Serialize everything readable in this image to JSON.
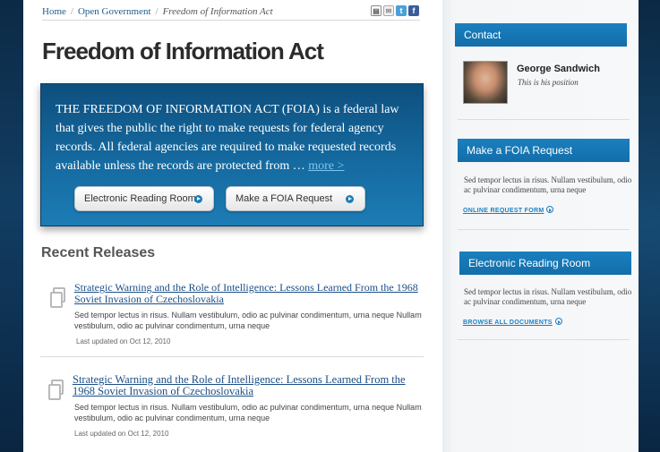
{
  "breadcrumb": {
    "home": "Home",
    "section": "Open Government",
    "current": "Freedom of Information Act"
  },
  "share": {
    "print_icon": "printer-icon",
    "email_icon": "envelope-icon",
    "twitter_icon": "twitter-icon",
    "facebook_icon": "facebook-icon"
  },
  "page_title": "Freedom of Information Act",
  "intro": {
    "text": "THE FREEDOM OF INFORMATION ACT (FOIA) is a federal law that gives the public the right to make requests for federal agency records. All federal agencies are required to make requested records available unless the records are protected from … ",
    "more": "more >",
    "button_reading_room": "Electronic Reading Room",
    "button_foia_request": "Make a FOIA Request"
  },
  "recent": {
    "title": "Recent Releases",
    "items": [
      {
        "title": "Strategic Warning and the Role of Intelligence: Lessons Learned From the 1968 Soviet Invasion of Czechoslovakia",
        "desc": "Sed tempor lectus in risus. Nullam vestibulum, odio ac pulvinar condimentum, urna neque Nullam vestibulum, odio ac pulvinar condimentum, urna neque",
        "date": "Last updated on   Oct 12, 2010"
      },
      {
        "title": "Strategic Warning and the Role of Intelligence: Lessons Learned From the 1968 Soviet Invasion of Czechoslovakia",
        "desc": "Sed tempor lectus in risus. Nullam vestibulum, odio ac pulvinar condimentum, urna neque Nullam vestibulum, odio ac pulvinar condimentum, urna neque",
        "date": "Last updated on   Oct 12, 2010"
      }
    ]
  },
  "sidebar": {
    "contact": {
      "header": "Contact",
      "name": "George Sandwich",
      "position": "This is his position"
    },
    "foia": {
      "header": "Make a FOIA Request",
      "desc": "Sed tempor lectus in risus. Nullam vestibulum, odio ac pulvinar condimentum, urna neque",
      "link": "ONLINE REQUEST FORM"
    },
    "reading_room": {
      "header": "Electronic Reading Room",
      "desc": "Sed tempor lectus in risus. Nullam vestibulum, odio ac pulvinar condimentum, urna neque",
      "link": "BROWSE ALL DOCUMENTS"
    }
  },
  "colors": {
    "accent": "#1a7fbf",
    "intro_bg": "#156aa0",
    "link": "#1a4f86"
  }
}
